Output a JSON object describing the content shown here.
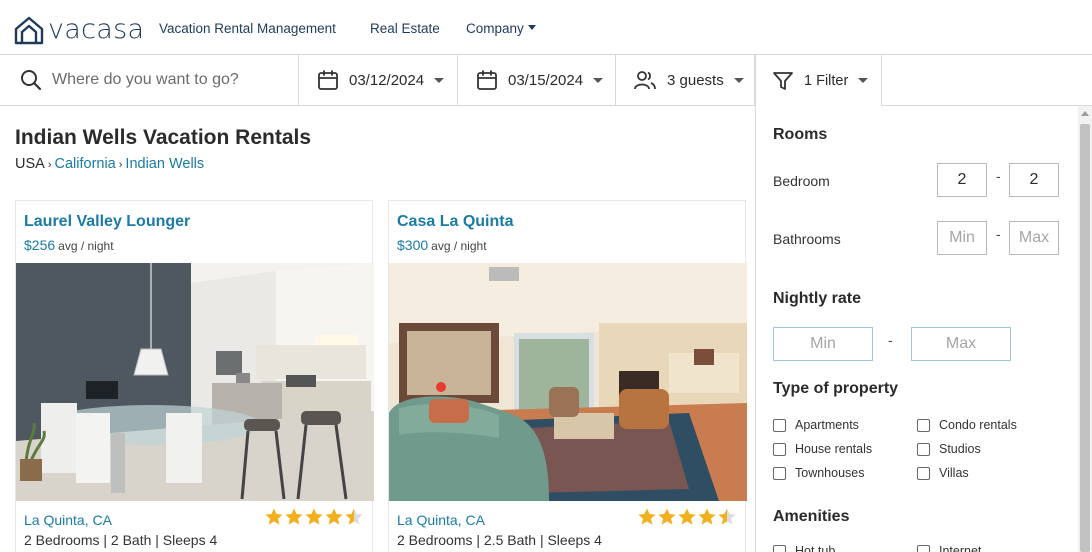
{
  "brand": {
    "name": "vacasa",
    "color": "#1f3a5a",
    "accent": "#1b7ba5"
  },
  "nav": {
    "links": [
      "Vacation Rental Management",
      "Real Estate",
      "Company"
    ]
  },
  "search": {
    "placeholder": "Where do you want to go?",
    "checkin": "03/12/2024",
    "checkout": "03/15/2024",
    "guests": "3 guests",
    "filter": "1 Filter"
  },
  "page": {
    "title": "Indian Wells Vacation Rentals",
    "breadcrumb": [
      "USA",
      "California",
      "Indian Wells"
    ],
    "breadcrumb_sep": "›"
  },
  "listings": [
    {
      "title": "Laurel Valley Lounger",
      "price": "$256",
      "price_unit": "avg / night",
      "location": "La Quinta, CA",
      "stats": "2 Bedrooms | 2 Bath | Sleeps 4",
      "rating": 4.5
    },
    {
      "title": "Casa La Quinta",
      "price": "$300",
      "price_unit": "avg / night",
      "location": "La Quinta, CA",
      "stats": "2 Bedrooms | 2.5 Bath | Sleeps 4",
      "rating": 4.5
    }
  ],
  "filters": {
    "rooms_heading": "Rooms",
    "bedroom_label": "Bedroom",
    "bedroom_min": "2",
    "bedroom_max": "2",
    "bathrooms_label": "Bathrooms",
    "min_placeholder": "Min",
    "max_placeholder": "Max",
    "range_sep": "-",
    "rate_heading": "Nightly rate",
    "type_heading": "Type of property",
    "property_types": [
      "Apartments",
      "Condo rentals",
      "House rentals",
      "Studios",
      "Townhouses",
      "Villas"
    ],
    "amenities_heading": "Amenities",
    "amenities": [
      "Hot tub",
      "Internet"
    ]
  }
}
